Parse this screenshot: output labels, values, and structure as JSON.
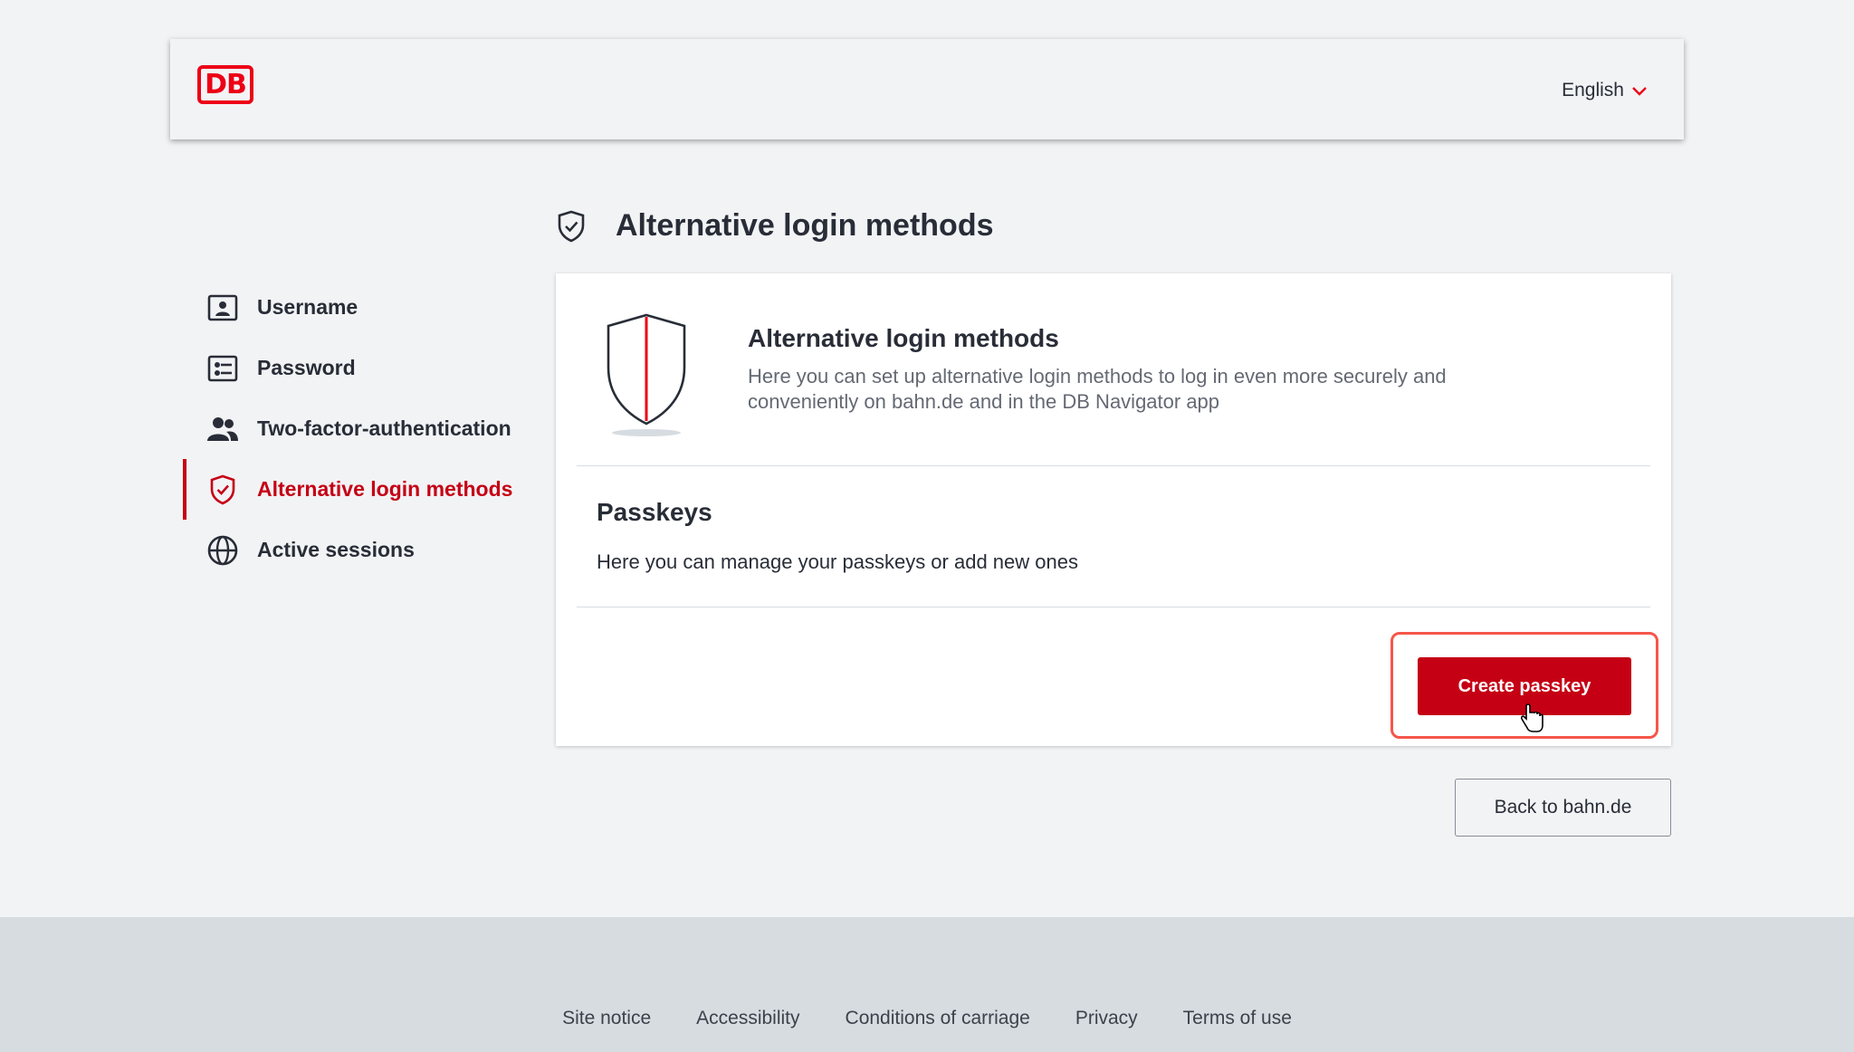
{
  "header": {
    "logo_text": "DB",
    "language": "English"
  },
  "page": {
    "title": "Alternative login methods"
  },
  "nav": {
    "items": [
      {
        "label": "Username",
        "icon": "user-card-icon"
      },
      {
        "label": "Password",
        "icon": "password-form-icon"
      },
      {
        "label": "Two-factor-authentication",
        "icon": "people-icon"
      },
      {
        "label": "Alternative login methods",
        "icon": "shield-check-icon",
        "active": true
      },
      {
        "label": "Active sessions",
        "icon": "globe-icon"
      }
    ]
  },
  "card": {
    "intro_title": "Alternative login methods",
    "intro_text": "Here you can set up alternative login methods to log in even more securely and conveniently on bahn.de and in the DB Navigator app",
    "passkeys_title": "Passkeys",
    "passkeys_text": "Here you can manage your passkeys or add new ones",
    "create_button": "Create passkey"
  },
  "back_button": "Back to bahn.de",
  "footer": {
    "links": [
      "Site notice",
      "Accessibility",
      "Conditions of carriage",
      "Privacy",
      "Terms of use"
    ]
  },
  "colors": {
    "brand_red": "#ec0016",
    "primary_red": "#c50014",
    "focus_ring": "#f5564a",
    "background": "#f2f3f5",
    "footer_bg": "#d7dce1"
  }
}
